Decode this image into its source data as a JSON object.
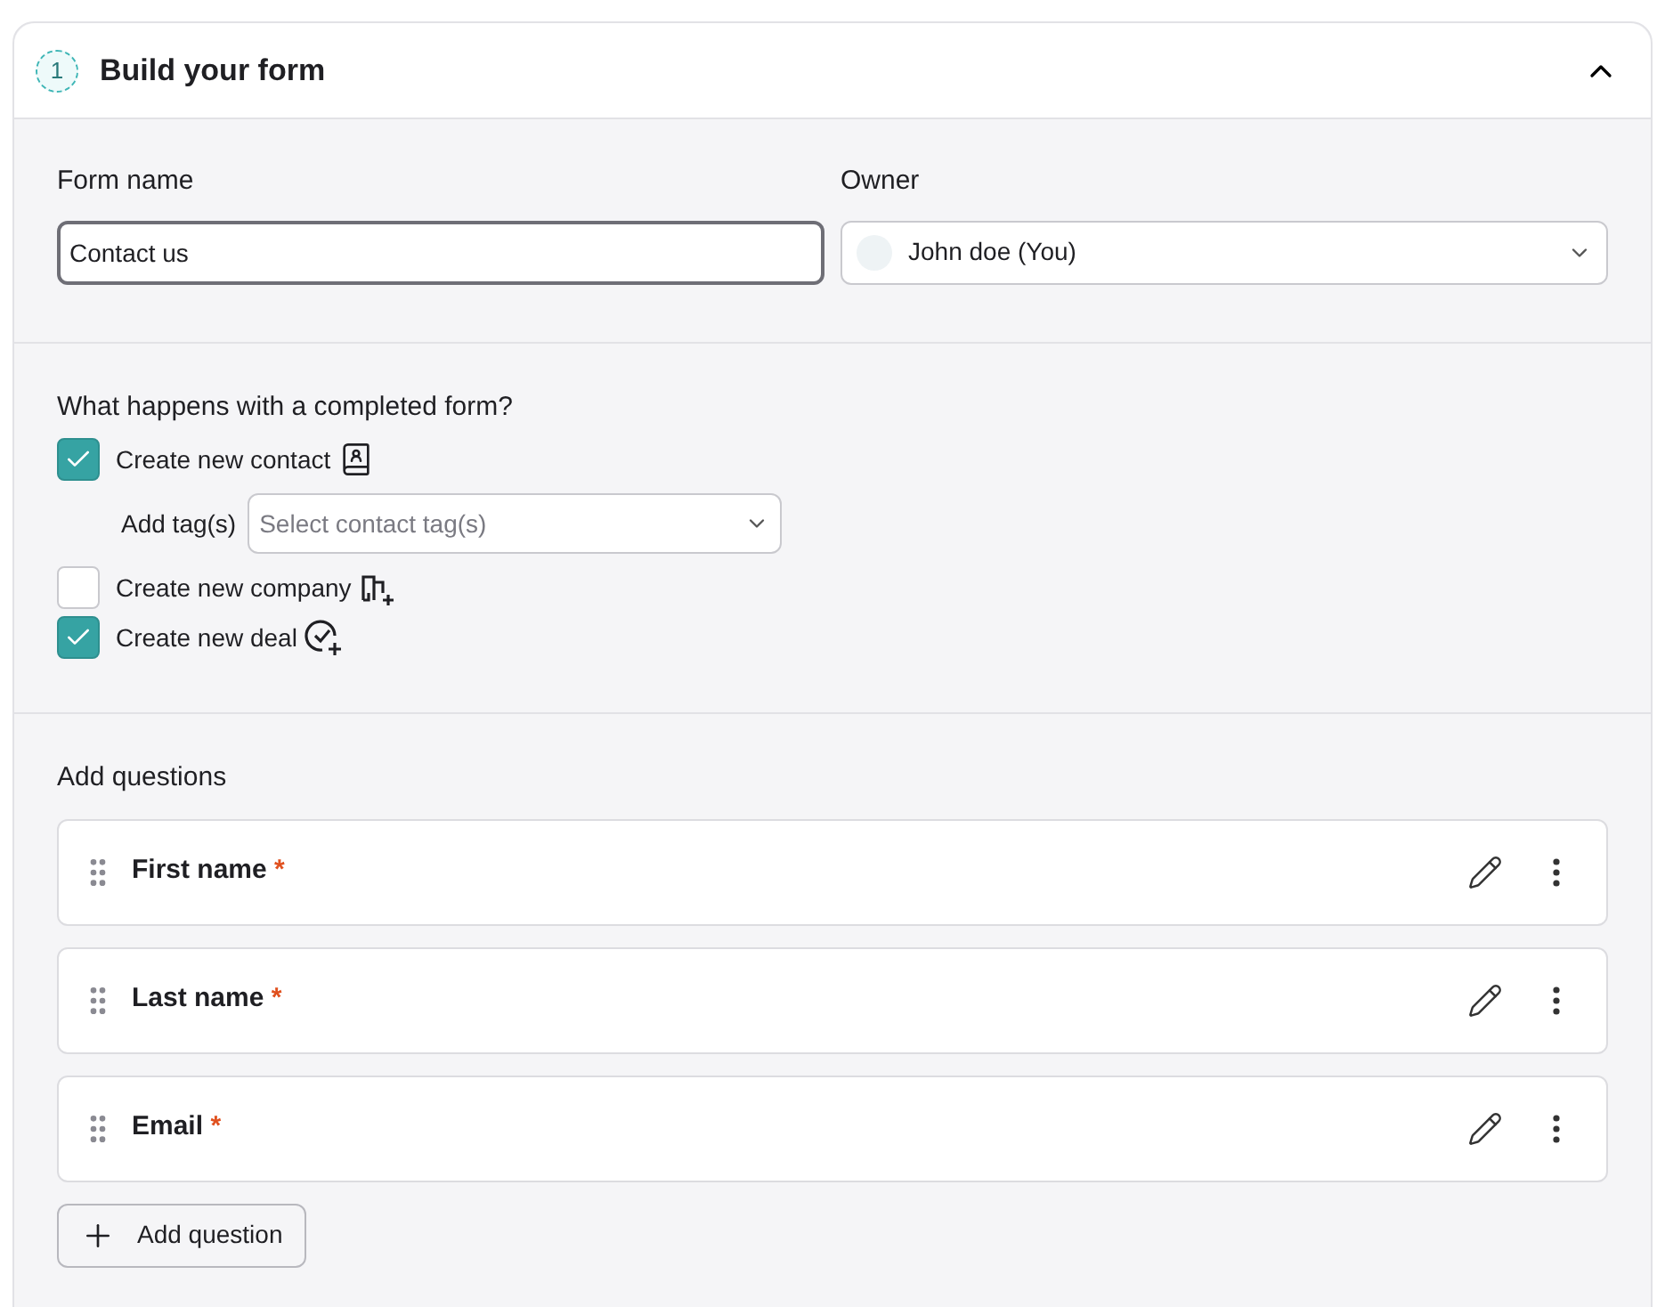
{
  "header": {
    "step": "1",
    "title": "Build your form",
    "expanded": true
  },
  "form_name": {
    "label": "Form name",
    "value": "Contact us"
  },
  "owner": {
    "label": "Owner",
    "value": "John doe (You)"
  },
  "outcome": {
    "title": "What happens with a completed form?",
    "options": [
      {
        "kind": "checkbox",
        "label": "Create new contact",
        "checked": true
      },
      {
        "kind": "select",
        "label": "Add tag(s)",
        "placeholder": "Select contact tag(s)"
      },
      {
        "kind": "checkbox",
        "label": "Create new company",
        "checked": false
      },
      {
        "kind": "checkbox",
        "label": "Create new deal",
        "checked": true
      }
    ]
  },
  "questions": {
    "title": "Add questions",
    "items": [
      {
        "label": "First name",
        "marker": "*"
      },
      {
        "label": "Last name",
        "marker": "*"
      },
      {
        "label": "Email",
        "marker": "*"
      }
    ],
    "add_button": "Add question"
  }
}
